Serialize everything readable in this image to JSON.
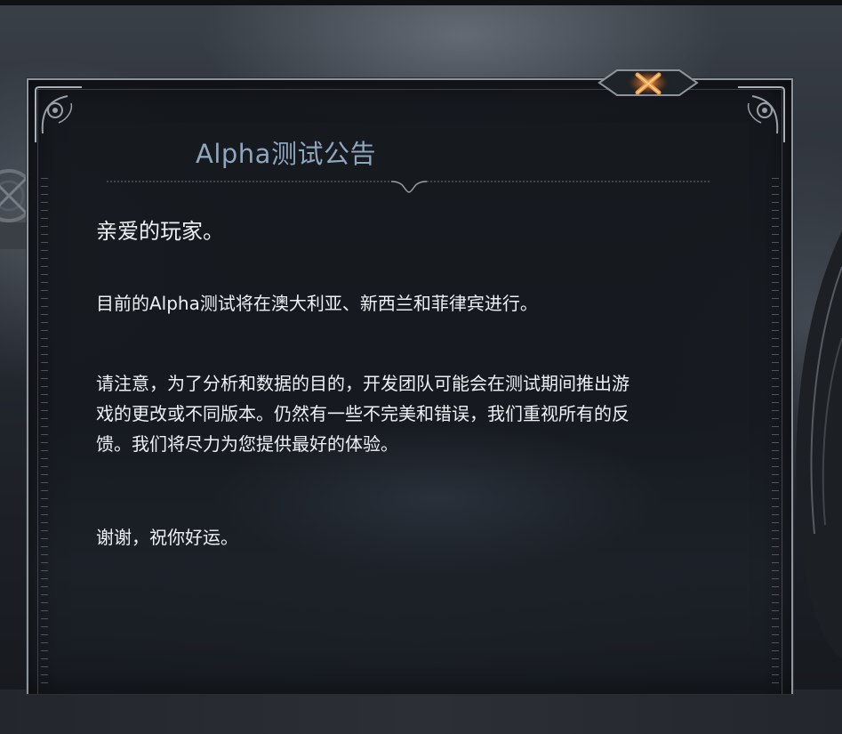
{
  "notice": {
    "title": "Alpha测试公告",
    "greeting": "亲爱的玩家。",
    "paragraph1": "目前的Alpha测试将在澳大利亚、新西兰和菲律宾进行。",
    "paragraph2_line1": "请注意，为了分析和数据的目的，开发团队可能会在测试期间推出游",
    "paragraph2_line2": "戏的更改或不同版本。仍然有一些不完美和错误，我们重视所有的反",
    "paragraph2_line3": "馈。我们将尽力为您提供最好的体验。",
    "closing": "谢谢，祝你好运。"
  },
  "icons": {
    "close": "close-x-icon"
  },
  "colors": {
    "title": "#8ea6bf",
    "text": "#eef1f4",
    "close_accent": "#e0802c",
    "frame": "#8e949c"
  }
}
